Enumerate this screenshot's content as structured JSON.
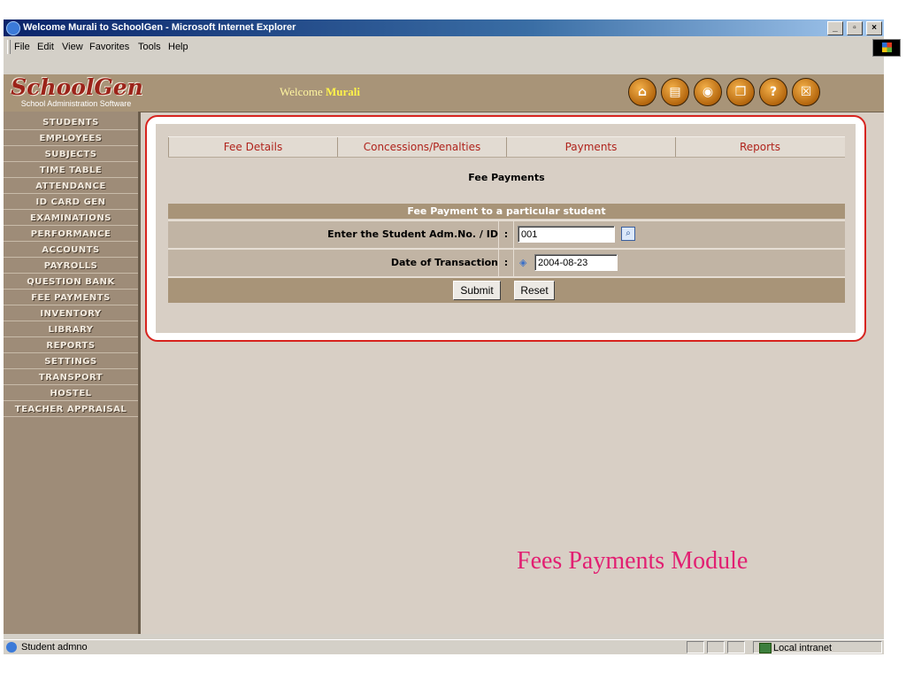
{
  "window": {
    "title": "Welcome Murali to SchoolGen - Microsoft Internet Explorer",
    "controls": [
      "_",
      "̅□",
      "X"
    ]
  },
  "menubar": {
    "items": [
      {
        "label": "File",
        "key": "F"
      },
      {
        "label": "Edit",
        "key": "E"
      },
      {
        "label": "View",
        "key": "V"
      },
      {
        "label": "Favorites",
        "key": "a"
      },
      {
        "label": "Tools",
        "key": "T"
      },
      {
        "label": "Help",
        "key": "H"
      }
    ]
  },
  "header": {
    "logo_name": "SchoolGen",
    "logo_subtitle": "School Administration Software",
    "welcome_prefix": "Welcome",
    "welcome_user": "Murali",
    "icons": [
      "home-icon",
      "book-icon",
      "globe-icon",
      "document-icon",
      "help-icon",
      "close-icon"
    ],
    "icon_glyphs": [
      "⌂",
      "▤",
      "◉",
      "❐",
      "?",
      "☒"
    ]
  },
  "sidebar": {
    "items": [
      "STUDENTS",
      "EMPLOYEES",
      "SUBJECTS",
      "TIME TABLE",
      "ATTENDANCE",
      "ID CARD GEN",
      "EXAMINATIONS",
      "PERFORMANCE",
      "ACCOUNTS",
      "PAYROLLS",
      "QUESTION BANK",
      "FEE PAYMENTS",
      "INVENTORY",
      "LIBRARY",
      "REPORTS",
      "SETTINGS",
      "TRANSPORT",
      "HOSTEL",
      "TEACHER APPRAISAL"
    ]
  },
  "tabs": [
    "Fee Details",
    "Concessions/Penalties",
    "Payments",
    "Reports"
  ],
  "main": {
    "heading": "Fee Payments",
    "form_title": "Fee Payment to a particular student",
    "fields": {
      "student_id_label": "Enter the Student Adm.No. / ID",
      "student_id_value": "001",
      "date_label": "Date of Transaction",
      "date_value": "2004-08-23"
    },
    "colon": ":",
    "submit_label": "Submit",
    "reset_label": "Reset"
  },
  "caption": "Fees Payments Module",
  "status": {
    "text": "Student admno",
    "zone": "Local intranet"
  },
  "colors": {
    "accent_red": "#d7231e",
    "tab_text": "#b0231c",
    "caption": "#e21f72",
    "header_bg": "#a89478"
  }
}
